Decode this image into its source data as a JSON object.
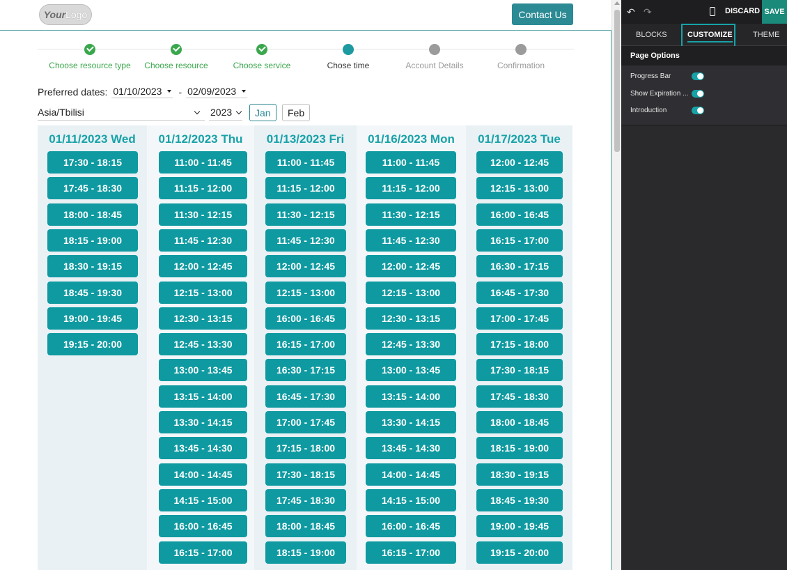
{
  "header": {
    "logo_part1": "Your",
    "logo_part2": "Logo",
    "contact_label": "Contact Us"
  },
  "progress": {
    "steps": [
      {
        "label": "Choose resource type",
        "state": "done"
      },
      {
        "label": "Choose resource",
        "state": "done"
      },
      {
        "label": "Choose service",
        "state": "done"
      },
      {
        "label": "Chose time",
        "state": "current"
      },
      {
        "label": "Account Details",
        "state": "todo"
      },
      {
        "label": "Confirmation",
        "state": "todo"
      }
    ]
  },
  "filters": {
    "preferred_label": "Preferred dates:",
    "date_from": "01/10/2023",
    "dash": "-",
    "date_to": "02/09/2023",
    "timezone": "Asia/Tbilisi",
    "year": "2023",
    "months": [
      "Jan",
      "Feb"
    ],
    "active_month": "Jan"
  },
  "calendar": {
    "days": [
      {
        "title": "01/11/2023 Wed",
        "slots": [
          "17:30 - 18:15",
          "17:45 - 18:30",
          "18:00 - 18:45",
          "18:15 - 19:00",
          "18:30 - 19:15",
          "18:45 - 19:30",
          "19:00 - 19:45",
          "19:15 - 20:00"
        ]
      },
      {
        "title": "01/12/2023 Thu",
        "slots": [
          "11:00 - 11:45",
          "11:15 - 12:00",
          "11:30 - 12:15",
          "11:45 - 12:30",
          "12:00 - 12:45",
          "12:15 - 13:00",
          "12:30 - 13:15",
          "12:45 - 13:30",
          "13:00 - 13:45",
          "13:15 - 14:00",
          "13:30 - 14:15",
          "13:45 - 14:30",
          "14:00 - 14:45",
          "14:15 - 15:00",
          "16:00 - 16:45",
          "16:15 - 17:00"
        ]
      },
      {
        "title": "01/13/2023 Fri",
        "slots": [
          "11:00 - 11:45",
          "11:15 - 12:00",
          "11:30 - 12:15",
          "11:45 - 12:30",
          "12:00 - 12:45",
          "12:15 - 13:00",
          "16:00 - 16:45",
          "16:15 - 17:00",
          "16:30 - 17:15",
          "16:45 - 17:30",
          "17:00 - 17:45",
          "17:15 - 18:00",
          "17:30 - 18:15",
          "17:45 - 18:30",
          "18:00 - 18:45",
          "18:15 - 19:00"
        ]
      },
      {
        "title": "01/16/2023 Mon",
        "slots": [
          "11:00 - 11:45",
          "11:15 - 12:00",
          "11:30 - 12:15",
          "11:45 - 12:30",
          "12:00 - 12:45",
          "12:15 - 13:00",
          "12:30 - 13:15",
          "12:45 - 13:30",
          "13:00 - 13:45",
          "13:15 - 14:00",
          "13:30 - 14:15",
          "13:45 - 14:30",
          "14:00 - 14:45",
          "14:15 - 15:00",
          "16:00 - 16:45",
          "16:15 - 17:00"
        ]
      },
      {
        "title": "01/17/2023 Tue",
        "slots": [
          "12:00 - 12:45",
          "12:15 - 13:00",
          "16:00 - 16:45",
          "16:15 - 17:00",
          "16:30 - 17:15",
          "16:45 - 17:30",
          "17:00 - 17:45",
          "17:15 - 18:00",
          "17:30 - 18:15",
          "17:45 - 18:30",
          "18:00 - 18:45",
          "18:15 - 19:00",
          "18:30 - 19:15",
          "18:45 - 19:30",
          "19:00 - 19:45",
          "19:15 - 20:00"
        ]
      }
    ]
  },
  "editor": {
    "undo_icon": "undo-icon",
    "redo_icon": "redo-icon",
    "discard_label": "DISCARD",
    "save_label": "SAVE",
    "tabs": [
      {
        "label": "BLOCKS"
      },
      {
        "label": "CUSTOMIZE"
      },
      {
        "label": "THEME"
      }
    ],
    "section_title": "Page Options",
    "options": [
      {
        "label": "Progress Bar",
        "enabled": true
      },
      {
        "label": "Show Expiration ...",
        "enabled": true
      },
      {
        "label": "Introduction",
        "enabled": true
      }
    ]
  },
  "colors": {
    "accent": "#17a2a8",
    "slot_bg": "#0f9aa1",
    "done_green": "#3aa74d",
    "panel_bg": "#2a2a2d"
  }
}
